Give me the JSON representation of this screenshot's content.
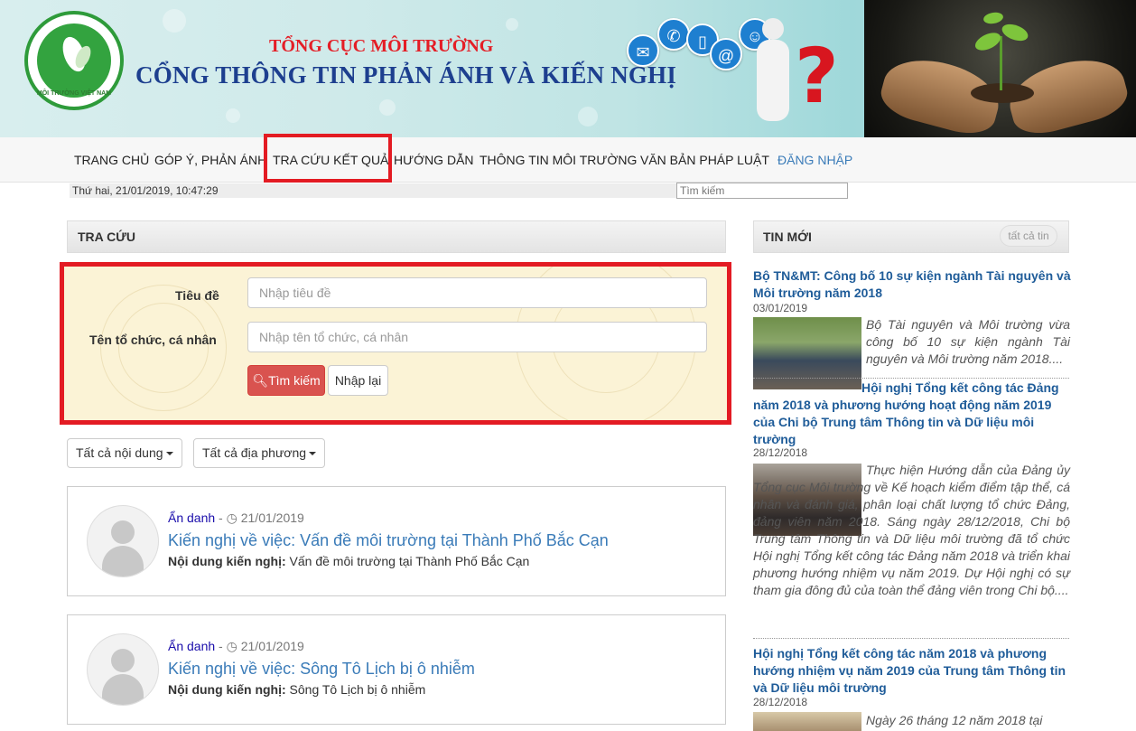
{
  "banner": {
    "logo_text": "MÔI TRƯỜNG VIỆT NAM",
    "subtitle": "TỔNG CỤC MÔI TRƯỜNG",
    "title": "CỔNG THÔNG TIN PHẢN ÁNH VÀ KIẾN NGHỊ"
  },
  "nav": {
    "items": [
      "TRANG CHỦ",
      "GÓP Ý, PHẢN ÁNH",
      "TRA CỨU KẾT QUẢ",
      "HƯỚNG DẪN",
      "THÔNG TIN MÔI TRƯỜNG",
      "VĂN BẢN PHÁP LUẬT"
    ],
    "login": "ĐĂNG NHẬP",
    "active": "TRA CỨU KẾT QUẢ"
  },
  "datetime": "Thứ hai, 21/01/2019, 10:47:29",
  "search": {
    "placeholder": "Tìm kiếm"
  },
  "lookup": {
    "heading": "TRA CỨU",
    "title_label": "Tiêu đề",
    "title_placeholder": "Nhập tiêu đề",
    "org_label": "Tên tổ chức, cá nhân",
    "org_placeholder": "Nhập tên tổ chức, cá nhân",
    "search_button": "Tìm kiếm",
    "reset_button": "Nhập lại"
  },
  "filters": {
    "content": "Tất cả nội dung",
    "region": "Tất cả địa phương"
  },
  "results": [
    {
      "author": "Ẩn danh",
      "date": "21/01/2019",
      "title": "Kiến nghị về việc: Vấn đề môi trường tại Thành Phố Bắc Cạn",
      "content_label": "Nội dung kiến nghị:",
      "content": "Vấn đề môi trường tại Thành Phố Bắc Cạn"
    },
    {
      "author": "Ẩn danh",
      "date": "21/01/2019",
      "title": "Kiến nghị về việc: Sông Tô Lịch bị ô nhiễm",
      "content_label": "Nội dung kiến nghị:",
      "content": "Sông Tô Lịch bị ô nhiễm"
    }
  ],
  "news": {
    "heading": "TIN MỚI",
    "all_button": "tất cả tin",
    "items": [
      {
        "title": "Bộ TN&MT: Công bố 10 sự kiện ngành Tài nguyên và Môi trường năm 2018",
        "date": "03/01/2019",
        "summary": "Bộ Tài nguyên và Môi trường vừa công bố 10 sự kiện ngành Tài nguyên và Môi trường năm 2018...."
      },
      {
        "title": "Hội nghị Tổng kết công tác Đảng năm 2018 và phương hướng hoạt động năm 2019 của Chi bộ Trung tâm Thông tin và Dữ liệu môi trường",
        "date": "28/12/2018",
        "summary": "Thực hiện Hướng dẫn của Đảng ủy Tổng cục Môi trường về Kế hoạch kiểm điểm tập thể, cá nhân và đánh giá, phân loại chất lượng tổ chức Đảng, đảng viên năm 2018. Sáng ngày 28/12/2018, Chi bộ Trung tâm Thông tin và Dữ liệu môi trường đã tổ chức Hội nghị Tổng kết công tác Đảng năm 2018 và triển khai phương hướng nhiệm vụ năm 2019. Dự Hội nghị có sự tham gia đông đủ của toàn thể đảng viên trong Chi bộ...."
      },
      {
        "title": "Hội nghị Tổng kết công tác năm 2018 và phương hướng nhiệm vụ năm 2019 của Trung tâm Thông tin và Dữ liệu môi trường",
        "date": "28/12/2018",
        "summary": "Ngày 26 tháng 12 năm 2018 tại"
      }
    ]
  },
  "colors": {
    "highlight": "#e31b23",
    "link": "#3a7bb8",
    "news_title": "#1f5c99",
    "search_button": "#d9534f"
  }
}
